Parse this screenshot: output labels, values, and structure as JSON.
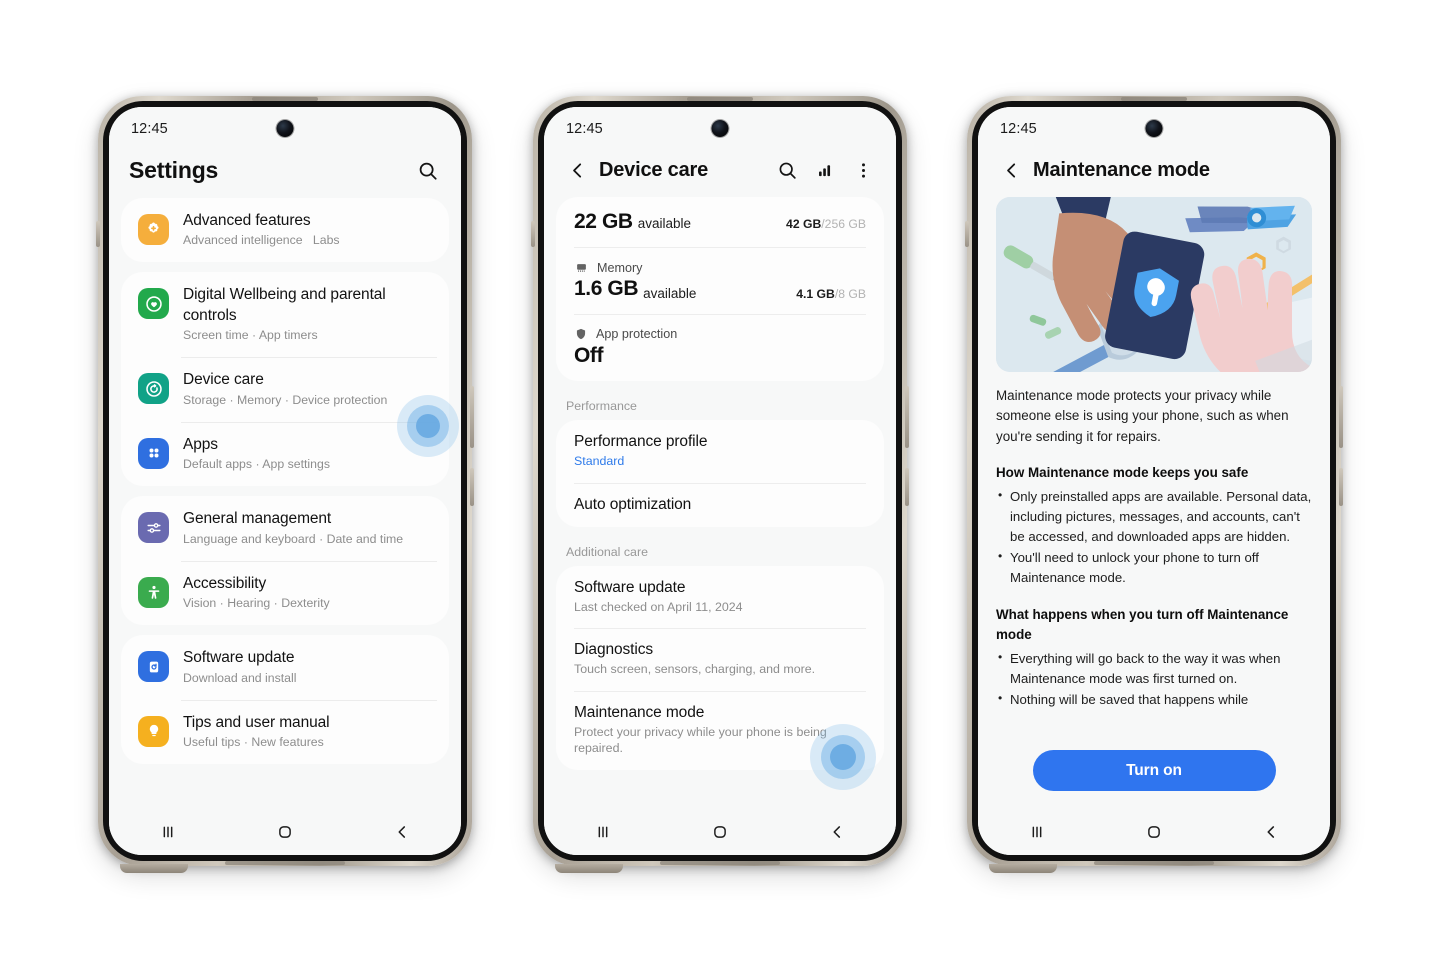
{
  "phones": [
    {
      "id": "settings",
      "status": {
        "time": "12:45"
      },
      "appbar": {
        "title": "Settings",
        "search_icon": "search-icon"
      },
      "groups": [
        {
          "items": [
            {
              "title": "Advanced features",
              "sub": "Advanced intelligence   Labs",
              "icon": "advanced-features-icon",
              "color": "#f5ae3c"
            }
          ]
        },
        {
          "items": [
            {
              "title": "Digital Wellbeing and parental controls",
              "sub": "Screen time  ·  App timers",
              "icon": "digital-wellbeing-icon",
              "color": "#22a94c"
            },
            {
              "title": "Device care",
              "sub": "Storage  ·  Memory  ·  Device protection",
              "icon": "device-care-icon",
              "color": "#11a287"
            },
            {
              "title": "Apps",
              "sub": "Default apps  ·  App settings",
              "icon": "apps-icon",
              "color": "#2f6fe0"
            }
          ]
        },
        {
          "items": [
            {
              "title": "General management",
              "sub": "Language and keyboard  ·  Date and time",
              "icon": "general-management-icon",
              "color": "#6a6ab0"
            },
            {
              "title": "Accessibility",
              "sub": "Vision  ·  Hearing  ·  Dexterity",
              "icon": "accessibility-icon",
              "color": "#3aab4e"
            }
          ]
        },
        {
          "items": [
            {
              "title": "Software update",
              "sub": "Download and install",
              "icon": "software-update-icon",
              "color": "#2f6fe0"
            },
            {
              "title": "Tips and user manual",
              "sub": "Useful tips  ·  New features",
              "icon": "tips-icon",
              "color": "#f5b01f"
            }
          ]
        }
      ],
      "tap_target": "device-protection-link"
    },
    {
      "id": "device-care",
      "status": {
        "time": "12:45"
      },
      "appbar": {
        "title": "Device care",
        "back_icon": "back-icon",
        "icons": [
          "search-icon",
          "chart-icon",
          "overflow-menu-icon"
        ]
      },
      "storage": {
        "value": "22 GB",
        "label": "available",
        "used": "42 GB",
        "total": "/256 GB"
      },
      "memory": {
        "header": "Memory",
        "value": "1.6 GB",
        "label": "available",
        "used": "4.1 GB",
        "total": "/8 GB",
        "bar_percent": 51
      },
      "app_protection": {
        "header": "App protection",
        "value": "Off"
      },
      "sections": [
        {
          "header": "Performance",
          "rows": [
            {
              "title": "Performance profile",
              "sub": "Standard",
              "accent": true
            },
            {
              "title": "Auto optimization",
              "sub": ""
            }
          ]
        },
        {
          "header": "Additional care",
          "rows": [
            {
              "title": "Software update",
              "sub": "Last checked on April 11, 2024",
              "accent": false
            },
            {
              "title": "Diagnostics",
              "sub": "Touch screen, sensors, charging, and more.",
              "accent": false
            },
            {
              "title": "Maintenance mode",
              "sub": "Protect your privacy while your phone is being repaired.",
              "accent": false
            }
          ]
        }
      ],
      "tap_target": "maintenance-mode-row"
    },
    {
      "id": "maintenance-mode",
      "status": {
        "time": "12:45"
      },
      "appbar": {
        "title": "Maintenance mode",
        "back_icon": "back-icon"
      },
      "hero_alt": "maintenance-illustration",
      "intro": "Maintenance mode protects your privacy while someone else is using your phone, such as when you're sending it for repairs.",
      "sections": [
        {
          "heading": "How Maintenance mode keeps you safe",
          "bullets": [
            "Only preinstalled apps are available. Personal data, including pictures, messages, and accounts, can't be accessed, and downloaded apps are hidden.",
            "You'll need to unlock your phone to turn off Maintenance mode."
          ]
        },
        {
          "heading": "What happens when you turn off Maintenance mode",
          "bullets": [
            "Everything will go back to the way it was when Maintenance mode was first turned on.",
            "Nothing will be saved that happens while"
          ]
        }
      ],
      "cta": {
        "label": "Turn on",
        "color": "#2f75ef"
      }
    }
  ],
  "navbar": {
    "recents_icon": "recents-icon",
    "home_icon": "home-icon",
    "back_icon": "back-icon"
  }
}
